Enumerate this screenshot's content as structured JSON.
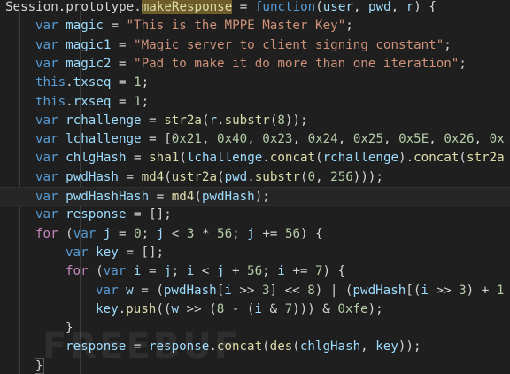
{
  "editor": {
    "lines": [
      [
        [
          "pun",
          "Session.prototype."
        ],
        [
          "sel",
          "makeResponse"
        ],
        [
          "pun",
          " = "
        ],
        [
          "kw",
          "function"
        ],
        [
          "pun",
          "("
        ],
        [
          "var",
          "user"
        ],
        [
          "pun",
          ", "
        ],
        [
          "var",
          "pwd"
        ],
        [
          "pun",
          ", "
        ],
        [
          "var",
          "r"
        ],
        [
          "pun",
          ") {"
        ]
      ],
      [
        [
          "kw",
          "var"
        ],
        [
          "pun",
          " "
        ],
        [
          "var",
          "magic"
        ],
        [
          "pun",
          " = "
        ],
        [
          "str",
          "\"This is the MPPE Master Key\""
        ],
        [
          "pun",
          ";"
        ]
      ],
      [
        [
          "kw",
          "var"
        ],
        [
          "pun",
          " "
        ],
        [
          "var",
          "magic1"
        ],
        [
          "pun",
          " = "
        ],
        [
          "str",
          "\"Magic server to client signing constant\""
        ],
        [
          "pun",
          ";"
        ]
      ],
      [
        [
          "kw",
          "var"
        ],
        [
          "pun",
          " "
        ],
        [
          "var",
          "magic2"
        ],
        [
          "pun",
          " = "
        ],
        [
          "str",
          "\"Pad to make it do more than one iteration\""
        ],
        [
          "pun",
          ";"
        ]
      ],
      [
        [
          "kw",
          "this"
        ],
        [
          "pun",
          "."
        ],
        [
          "var",
          "txseq"
        ],
        [
          "pun",
          " = "
        ],
        [
          "num",
          "1"
        ],
        [
          "pun",
          ";"
        ]
      ],
      [
        [
          "kw",
          "this"
        ],
        [
          "pun",
          "."
        ],
        [
          "var",
          "rxseq"
        ],
        [
          "pun",
          " = "
        ],
        [
          "num",
          "1"
        ],
        [
          "pun",
          ";"
        ]
      ],
      [
        [
          "kw",
          "var"
        ],
        [
          "pun",
          " "
        ],
        [
          "var",
          "rchallenge"
        ],
        [
          "pun",
          " = "
        ],
        [
          "fn",
          "str2a"
        ],
        [
          "pun",
          "("
        ],
        [
          "var",
          "r"
        ],
        [
          "pun",
          "."
        ],
        [
          "fn",
          "substr"
        ],
        [
          "pun",
          "("
        ],
        [
          "num",
          "8"
        ],
        [
          "pun",
          "));"
        ]
      ],
      [
        [
          "kw",
          "var"
        ],
        [
          "pun",
          " "
        ],
        [
          "var",
          "lchallenge"
        ],
        [
          "pun",
          " = ["
        ],
        [
          "num",
          "0x21"
        ],
        [
          "pun",
          ", "
        ],
        [
          "num",
          "0x40"
        ],
        [
          "pun",
          ", "
        ],
        [
          "num",
          "0x23"
        ],
        [
          "pun",
          ", "
        ],
        [
          "num",
          "0x24"
        ],
        [
          "pun",
          ", "
        ],
        [
          "num",
          "0x25"
        ],
        [
          "pun",
          ", "
        ],
        [
          "num",
          "0x5E"
        ],
        [
          "pun",
          ", "
        ],
        [
          "num",
          "0x26"
        ],
        [
          "pun",
          ", "
        ],
        [
          "num",
          "0x"
        ]
      ],
      [
        [
          "kw",
          "var"
        ],
        [
          "pun",
          " "
        ],
        [
          "var",
          "chlgHash"
        ],
        [
          "pun",
          " = "
        ],
        [
          "fn",
          "sha1"
        ],
        [
          "pun",
          "("
        ],
        [
          "var",
          "lchallenge"
        ],
        [
          "pun",
          "."
        ],
        [
          "fn",
          "concat"
        ],
        [
          "pun",
          "("
        ],
        [
          "var",
          "rchallenge"
        ],
        [
          "pun",
          ")."
        ],
        [
          "fn",
          "concat"
        ],
        [
          "pun",
          "("
        ],
        [
          "fn",
          "str2a"
        ]
      ],
      [
        [
          "kw",
          "var"
        ],
        [
          "pun",
          " "
        ],
        [
          "var",
          "pwdHash"
        ],
        [
          "pun",
          " = "
        ],
        [
          "fn",
          "md4"
        ],
        [
          "pun",
          "("
        ],
        [
          "fn",
          "ustr2a"
        ],
        [
          "pun",
          "("
        ],
        [
          "var",
          "pwd"
        ],
        [
          "pun",
          "."
        ],
        [
          "fn",
          "substr"
        ],
        [
          "pun",
          "("
        ],
        [
          "num",
          "0"
        ],
        [
          "pun",
          ", "
        ],
        [
          "num",
          "256"
        ],
        [
          "pun",
          ")));"
        ]
      ],
      [
        [
          "kw",
          "var"
        ],
        [
          "pun",
          " "
        ],
        [
          "var",
          "pwdHashHash"
        ],
        [
          "pun",
          " = "
        ],
        [
          "fn",
          "md4"
        ],
        [
          "pun",
          "("
        ],
        [
          "var",
          "pwdHash"
        ],
        [
          "pun",
          ");"
        ]
      ],
      [
        [
          "kw",
          "var"
        ],
        [
          "pun",
          " "
        ],
        [
          "var",
          "response"
        ],
        [
          "pun",
          " = [];"
        ]
      ],
      [
        [
          "ctrl",
          "for"
        ],
        [
          "pun",
          " ("
        ],
        [
          "kw",
          "var"
        ],
        [
          "pun",
          " "
        ],
        [
          "var",
          "j"
        ],
        [
          "pun",
          " = "
        ],
        [
          "num",
          "0"
        ],
        [
          "pun",
          "; "
        ],
        [
          "var",
          "j"
        ],
        [
          "pun",
          " < "
        ],
        [
          "num",
          "3"
        ],
        [
          "pun",
          " * "
        ],
        [
          "num",
          "56"
        ],
        [
          "pun",
          "; "
        ],
        [
          "var",
          "j"
        ],
        [
          "pun",
          " += "
        ],
        [
          "num",
          "56"
        ],
        [
          "pun",
          ") {"
        ]
      ],
      [
        [
          "kw",
          "var"
        ],
        [
          "pun",
          " "
        ],
        [
          "var",
          "key"
        ],
        [
          "pun",
          " = [];"
        ]
      ],
      [
        [
          "ctrl",
          "for"
        ],
        [
          "pun",
          " ("
        ],
        [
          "kw",
          "var"
        ],
        [
          "pun",
          " "
        ],
        [
          "var",
          "i"
        ],
        [
          "pun",
          " = "
        ],
        [
          "var",
          "j"
        ],
        [
          "pun",
          "; "
        ],
        [
          "var",
          "i"
        ],
        [
          "pun",
          " < "
        ],
        [
          "var",
          "j"
        ],
        [
          "pun",
          " + "
        ],
        [
          "num",
          "56"
        ],
        [
          "pun",
          "; "
        ],
        [
          "var",
          "i"
        ],
        [
          "pun",
          " += "
        ],
        [
          "num",
          "7"
        ],
        [
          "pun",
          ") {"
        ]
      ],
      [
        [
          "kw",
          "var"
        ],
        [
          "pun",
          " "
        ],
        [
          "var",
          "w"
        ],
        [
          "pun",
          " = ("
        ],
        [
          "var",
          "pwdHash"
        ],
        [
          "pun",
          "["
        ],
        [
          "var",
          "i"
        ],
        [
          "pun",
          " >> "
        ],
        [
          "num",
          "3"
        ],
        [
          "pun",
          "] << "
        ],
        [
          "num",
          "8"
        ],
        [
          "pun",
          ") | ("
        ],
        [
          "var",
          "pwdHash"
        ],
        [
          "pun",
          "[("
        ],
        [
          "var",
          "i"
        ],
        [
          "pun",
          " >> "
        ],
        [
          "num",
          "3"
        ],
        [
          "pun",
          ") + "
        ],
        [
          "num",
          "1"
        ]
      ],
      [
        [
          "var",
          "key"
        ],
        [
          "pun",
          "."
        ],
        [
          "fn",
          "push"
        ],
        [
          "pun",
          "(("
        ],
        [
          "var",
          "w"
        ],
        [
          "pun",
          " >> ("
        ],
        [
          "num",
          "8"
        ],
        [
          "pun",
          " - ("
        ],
        [
          "var",
          "i"
        ],
        [
          "pun",
          " & "
        ],
        [
          "num",
          "7"
        ],
        [
          "pun",
          "))) & "
        ],
        [
          "num",
          "0xfe"
        ],
        [
          "pun",
          ");"
        ]
      ],
      [
        [
          "pun",
          "}"
        ]
      ],
      [
        [
          "var",
          "response"
        ],
        [
          "pun",
          " = "
        ],
        [
          "var",
          "response"
        ],
        [
          "pun",
          "."
        ],
        [
          "fn",
          "concat"
        ],
        [
          "pun",
          "("
        ],
        [
          "fn",
          "des"
        ],
        [
          "pun",
          "("
        ],
        [
          "var",
          "chlgHash"
        ],
        [
          "pun",
          ", "
        ],
        [
          "var",
          "key"
        ],
        [
          "pun",
          "));"
        ]
      ],
      [
        [
          "brace",
          "}"
        ]
      ]
    ],
    "watermark": "FREEBUF"
  }
}
